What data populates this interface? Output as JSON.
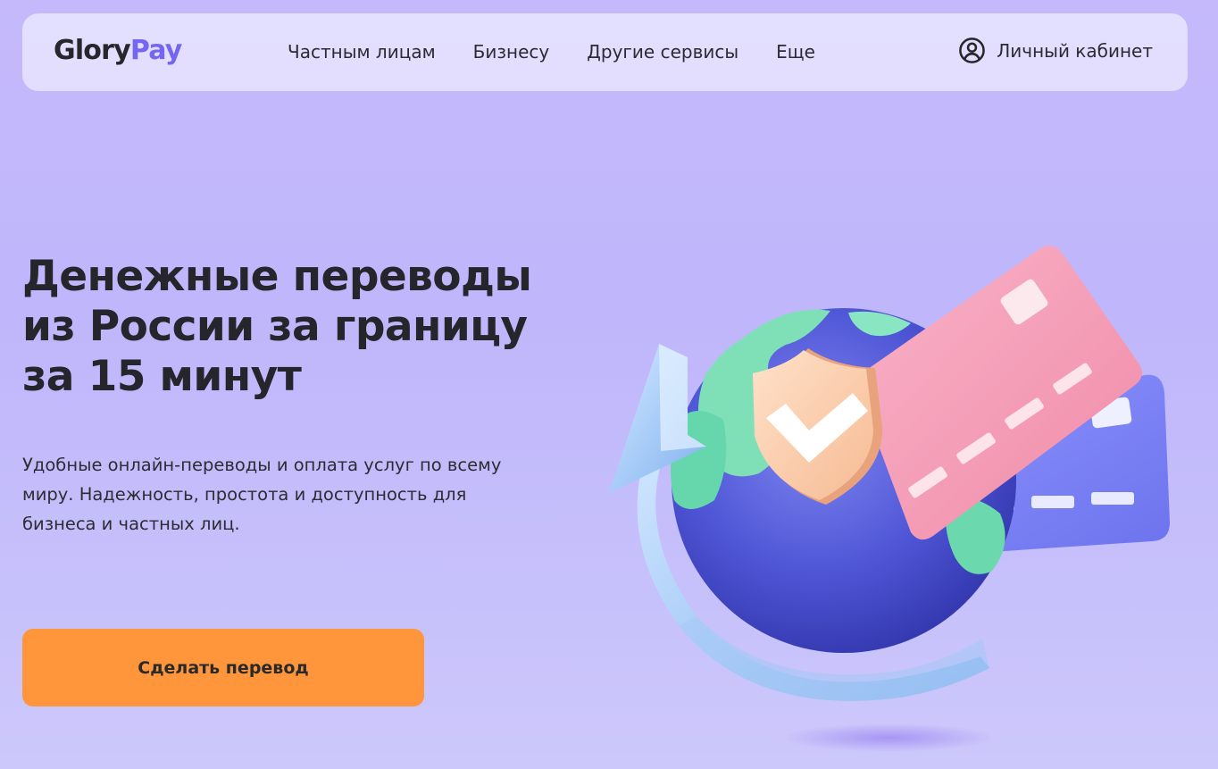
{
  "header": {
    "logo": {
      "part1": "Glory",
      "part2": "Pay"
    },
    "nav": [
      {
        "label": "Частным лицам"
      },
      {
        "label": "Бизнесу"
      },
      {
        "label": "Другие сервисы"
      },
      {
        "label": "Еще"
      }
    ],
    "account": {
      "icon": "user-circle-icon",
      "label": "Личный кабинет"
    }
  },
  "hero": {
    "title_lines": [
      "Денежные переводы",
      "из России за границу",
      "за 15 минут"
    ],
    "subtitle_lines": [
      "Удобные онлайн-переводы и оплата услуг по всему",
      "миру. Надежность, простота и доступность для",
      "бизнеса и частных лиц."
    ],
    "cta_label": "Сделать перевод"
  },
  "illustration": {
    "items": [
      "globe",
      "circular-arrow",
      "shield-check-icon",
      "pink-card",
      "blue-card"
    ]
  },
  "colors": {
    "background": "#c2b8fb",
    "header_bg": "#e9e6ff",
    "brand_accent": "#7566f2",
    "cta": "#ff963c",
    "text": "#26252b"
  }
}
